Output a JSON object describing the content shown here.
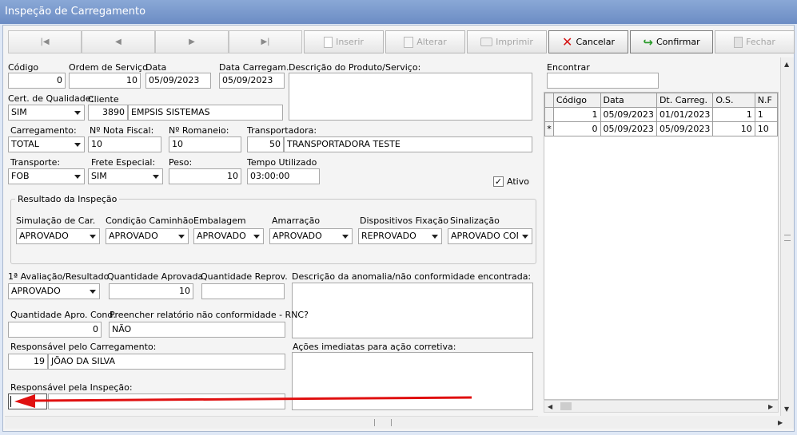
{
  "window": {
    "title": "Inspeção de Carregamento"
  },
  "toolbar": {
    "nav": [
      "|◀",
      "◀",
      "▶",
      "▶|"
    ],
    "inserir": "Inserir",
    "alterar": "Alterar",
    "imprimir": "Imprimir",
    "cancelar": "Cancelar",
    "confirmar": "Confirmar",
    "fechar": "Fechar"
  },
  "form": {
    "codigo_label": "Código",
    "codigo": "0",
    "os_label": "Ordem de Serviço",
    "os": "10",
    "data_label": "Data",
    "data": "05/09/2023",
    "data_carreg_label": "Data Carregam.",
    "data_carreg": "05/09/2023",
    "descricao_label": "Descrição do Produto/Serviço:",
    "cert_label": "Cert. de Qualidade:",
    "cert": "SIM",
    "cliente_label": "Cliente",
    "cliente_cod": "3890",
    "cliente_nome": "EMPSIS SISTEMAS",
    "carregamento_label": "Carregamento:",
    "carregamento": "TOTAL",
    "nf_label": "Nº Nota Fiscal:",
    "nf": "10",
    "romaneio_label": "Nº Romaneio:",
    "romaneio": "10",
    "transportadora_label": "Transportadora:",
    "transp_cod": "50",
    "transp_nome": "TRANSPORTADORA TESTE",
    "transporte_label": "Transporte:",
    "transporte": "FOB",
    "frete_label": "Frete Especial:",
    "frete": "SIM",
    "peso_label": "Peso:",
    "peso": "10",
    "tempo_label": "Tempo Utilizado",
    "tempo": "03:00:00",
    "ativo_label": "Ativo"
  },
  "resultado": {
    "title": "Resultado da Inspeção",
    "simulacao_label": "Simulação de Car.",
    "simulacao": "APROVADO",
    "condicao_label": "Condição Caminhão",
    "condicao": "APROVADO",
    "embalagem_label": "Embalagem",
    "embalagem": "APROVADO",
    "amarracao_label": "Amarração",
    "amarracao": "APROVADO",
    "dispositivos_label": "Dispositivos Fixação",
    "dispositivos": "REPROVADO",
    "sinalizacao_label": "Sinalização",
    "sinalizacao": "APROVADO CONI"
  },
  "avaliacao": {
    "avaliacao_label": "1ª Avaliação/Resultado",
    "avaliacao": "APROVADO",
    "qtd_aprov_label": "Quantidade Aprovada",
    "qtd_aprov": "10",
    "qtd_reprov_label": "Quantidade Reprov.",
    "qtd_reprov": "",
    "anomalia_label": "Descrição da anomalia/não conformidade encontrada:",
    "qtd_apro_cond_label": "Quantidade Apro. Cond.",
    "qtd_apro_cond": "0",
    "rnc_label": "Preencher relatório não conformidade - RNC?",
    "rnc": "NÃO",
    "resp_carreg_label": "Responsável pelo Carregamento:",
    "resp_carreg_cod": "19",
    "resp_carreg_nome": "JÕAO DA SILVA",
    "acoes_label": "Ações imediatas para ação corretiva:",
    "resp_insp_label": "Responsável pela Inspeção:",
    "resp_insp_cod": "",
    "resp_insp_nome": ""
  },
  "search": {
    "label": "Encontrar",
    "value": ""
  },
  "grid": {
    "headers": [
      "Código",
      "Data",
      "Dt. Carreg.",
      "O.S.",
      "N.F"
    ],
    "rows": [
      {
        "indicator": "",
        "codigo": "1",
        "data": "05/09/2023",
        "dt_carreg": "01/01/2023",
        "os": "1",
        "nf": "1"
      },
      {
        "indicator": "*",
        "codigo": "0",
        "data": "05/09/2023",
        "dt_carreg": "05/09/2023",
        "os": "10",
        "nf": "10"
      }
    ]
  },
  "colors": {
    "title_bar": "#7a9ad0",
    "arrow": "#e01010"
  }
}
